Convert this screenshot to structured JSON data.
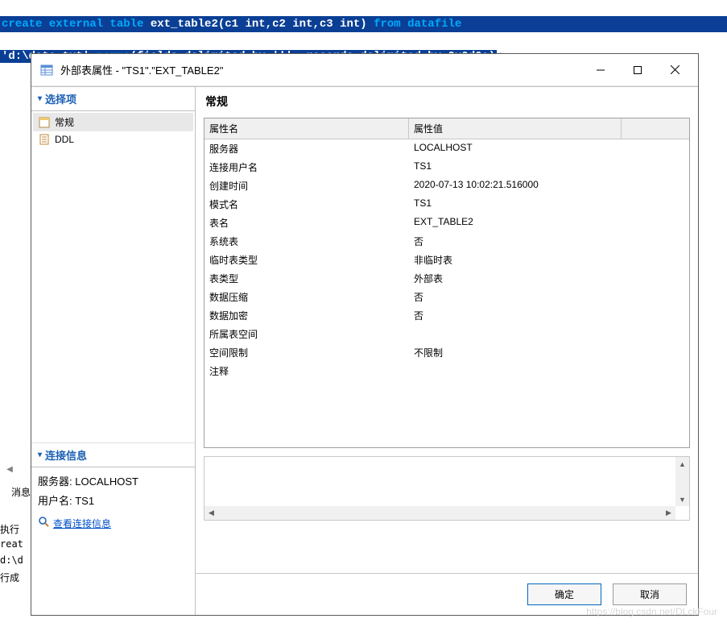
{
  "sql": {
    "line1_pre_kw1": "create external table",
    "line1_mid": " ext_table2(c1 int,c2 int,c3 int) ",
    "line1_kw2": "from datafile",
    "line2_sel_pre": "'d:\\data.txt' ",
    "line2_sel_kw": "parms",
    "line2_sel_post": "(fields delimited by '|', records delimited by 0x0d0a)",
    "line2_end": ";"
  },
  "dialog": {
    "title": "外部表属性 - \"TS1\".\"EXT_TABLE2\"",
    "options_header": "选择项",
    "options": [
      {
        "label": "常规",
        "selected": true,
        "icon": "page-icon"
      },
      {
        "label": "DDL",
        "selected": false,
        "icon": "doc-icon"
      }
    ],
    "conn_header": "连接信息",
    "conn_server_label": "服务器: ",
    "conn_server_value": "LOCALHOST",
    "conn_user_label": "用户名: ",
    "conn_user_value": "TS1",
    "conn_link_text": "查看连接信息",
    "main_title": "常规",
    "col_name": "属性名",
    "col_value": "属性值",
    "rows": [
      {
        "name": "服务器",
        "value": "LOCALHOST"
      },
      {
        "name": "连接用户名",
        "value": "TS1"
      },
      {
        "name": "创建时间",
        "value": "2020-07-13 10:02:21.516000"
      },
      {
        "name": "模式名",
        "value": "TS1"
      },
      {
        "name": "表名",
        "value": "EXT_TABLE2"
      },
      {
        "name": "系统表",
        "value": "否"
      },
      {
        "name": "临时表类型",
        "value": "非临时表"
      },
      {
        "name": "表类型",
        "value": "外部表"
      },
      {
        "name": "数据压缩",
        "value": "否"
      },
      {
        "name": "数据加密",
        "value": "否"
      },
      {
        "name": "所属表空间",
        "value": ""
      },
      {
        "name": "空间限制",
        "value": "不限制"
      },
      {
        "name": "注释",
        "value": ""
      }
    ],
    "ok": "确定",
    "cancel": "取消"
  },
  "background": {
    "msg_tab": "消息",
    "frag1": "执行",
    "frag2": "reat",
    "frag3": "d:\\d",
    "frag4": "行成"
  },
  "watermark": "https://blog.csdn.net/DLckFour"
}
